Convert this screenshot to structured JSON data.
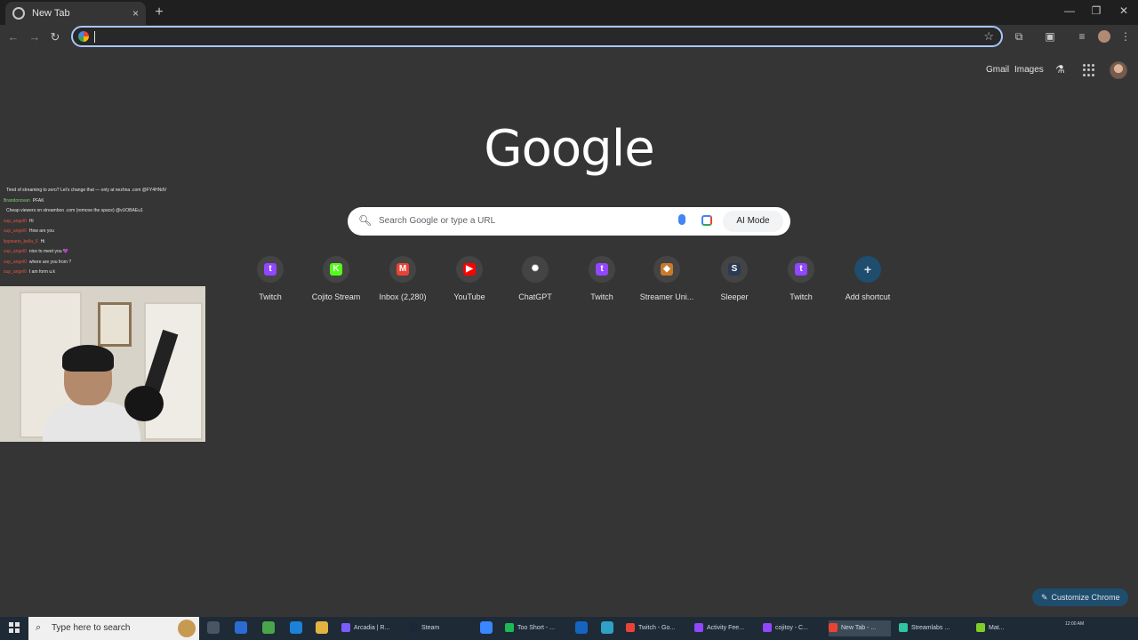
{
  "browser": {
    "tab": {
      "title": "New Tab",
      "favicon": "chrome-newtab-icon",
      "close": "×"
    },
    "new_tab": "+",
    "window_controls": {
      "minimize": "—",
      "restore": "❐",
      "close": "✕"
    },
    "nav": {
      "back": "←",
      "forward": "→",
      "reload": "↻"
    },
    "omnibox": {
      "value": ""
    }
  },
  "header": {
    "gmail": "Gmail",
    "images": "Images"
  },
  "logo": "Google",
  "search": {
    "placeholder": "Search Google or type a URL",
    "ai_mode": "AI Mode"
  },
  "shortcuts": [
    {
      "label": "Twitch",
      "icon": "twitch-icon",
      "color": "#9146ff",
      "glyph": "t"
    },
    {
      "label": "Cojito Stream",
      "icon": "kick-icon",
      "color": "#53fc18",
      "glyph": "K"
    },
    {
      "label": "Inbox (2,280)",
      "icon": "gmail-icon",
      "color": "#ea4335",
      "glyph": "M"
    },
    {
      "label": "YouTube",
      "icon": "youtube-icon",
      "color": "#ff0000",
      "glyph": "▶"
    },
    {
      "label": "ChatGPT",
      "icon": "chatgpt-icon",
      "color": "#444444",
      "glyph": "✺"
    },
    {
      "label": "Twitch",
      "icon": "twitch-icon",
      "color": "#9146ff",
      "glyph": "t"
    },
    {
      "label": "Streamer Uni...",
      "icon": "streamer-university-icon",
      "color": "#c77a2e",
      "glyph": "◆"
    },
    {
      "label": "Sleeper",
      "icon": "sleeper-icon",
      "color": "#2b3a55",
      "glyph": "S"
    },
    {
      "label": "Twitch",
      "icon": "twitch-icon",
      "color": "#9146ff",
      "glyph": "t"
    },
    {
      "label": "Add shortcut",
      "icon": "plus-icon",
      "color": "#1e4d6e",
      "glyph": "+"
    }
  ],
  "chat": [
    {
      "user": "",
      "text": "Tired of streaming to zero? Let's change that — only at nezhna .com @FY4HNdV"
    },
    {
      "user": "Brandonovan",
      "text": "PFAK"
    },
    {
      "user": "",
      "text": "Cheap viewers on streamboo .com (remove the space) @vUOBAEu1"
    },
    {
      "user": "sup_angel0",
      "text": "Hi"
    },
    {
      "user": "sup_angel0",
      "text": "How are you"
    },
    {
      "user": "lippwarts_bella_6",
      "text": "Hi"
    },
    {
      "user": "sup_angel0",
      "text": "nice to meet you 💜"
    },
    {
      "user": "sup_angel0",
      "text": "where are you from ?"
    },
    {
      "user": "sup_angel0",
      "text": "I am form u.k"
    }
  ],
  "customize": "Customize Chrome",
  "taskbar": {
    "search_placeholder": "Type here to search",
    "items": [
      {
        "label": "Arcadia | R...",
        "color": "#7b5cff"
      },
      {
        "label": "Steam",
        "color": "#1b2838"
      },
      {
        "label": "Too Short - ...",
        "color": "#1db954"
      },
      {
        "label": "Twitch - Go...",
        "color": "#ea4335"
      },
      {
        "label": "Activity Fee...",
        "color": "#9146ff"
      },
      {
        "label": "cojitoy - C...",
        "color": "#9146ff"
      },
      {
        "label": "New Tab - ...",
        "color": "#ea4335"
      },
      {
        "label": "Streamlabs ...",
        "color": "#31c3a2"
      },
      {
        "label": "Mat...",
        "color": "#80cc28"
      }
    ],
    "clock": "12:00 AM"
  }
}
